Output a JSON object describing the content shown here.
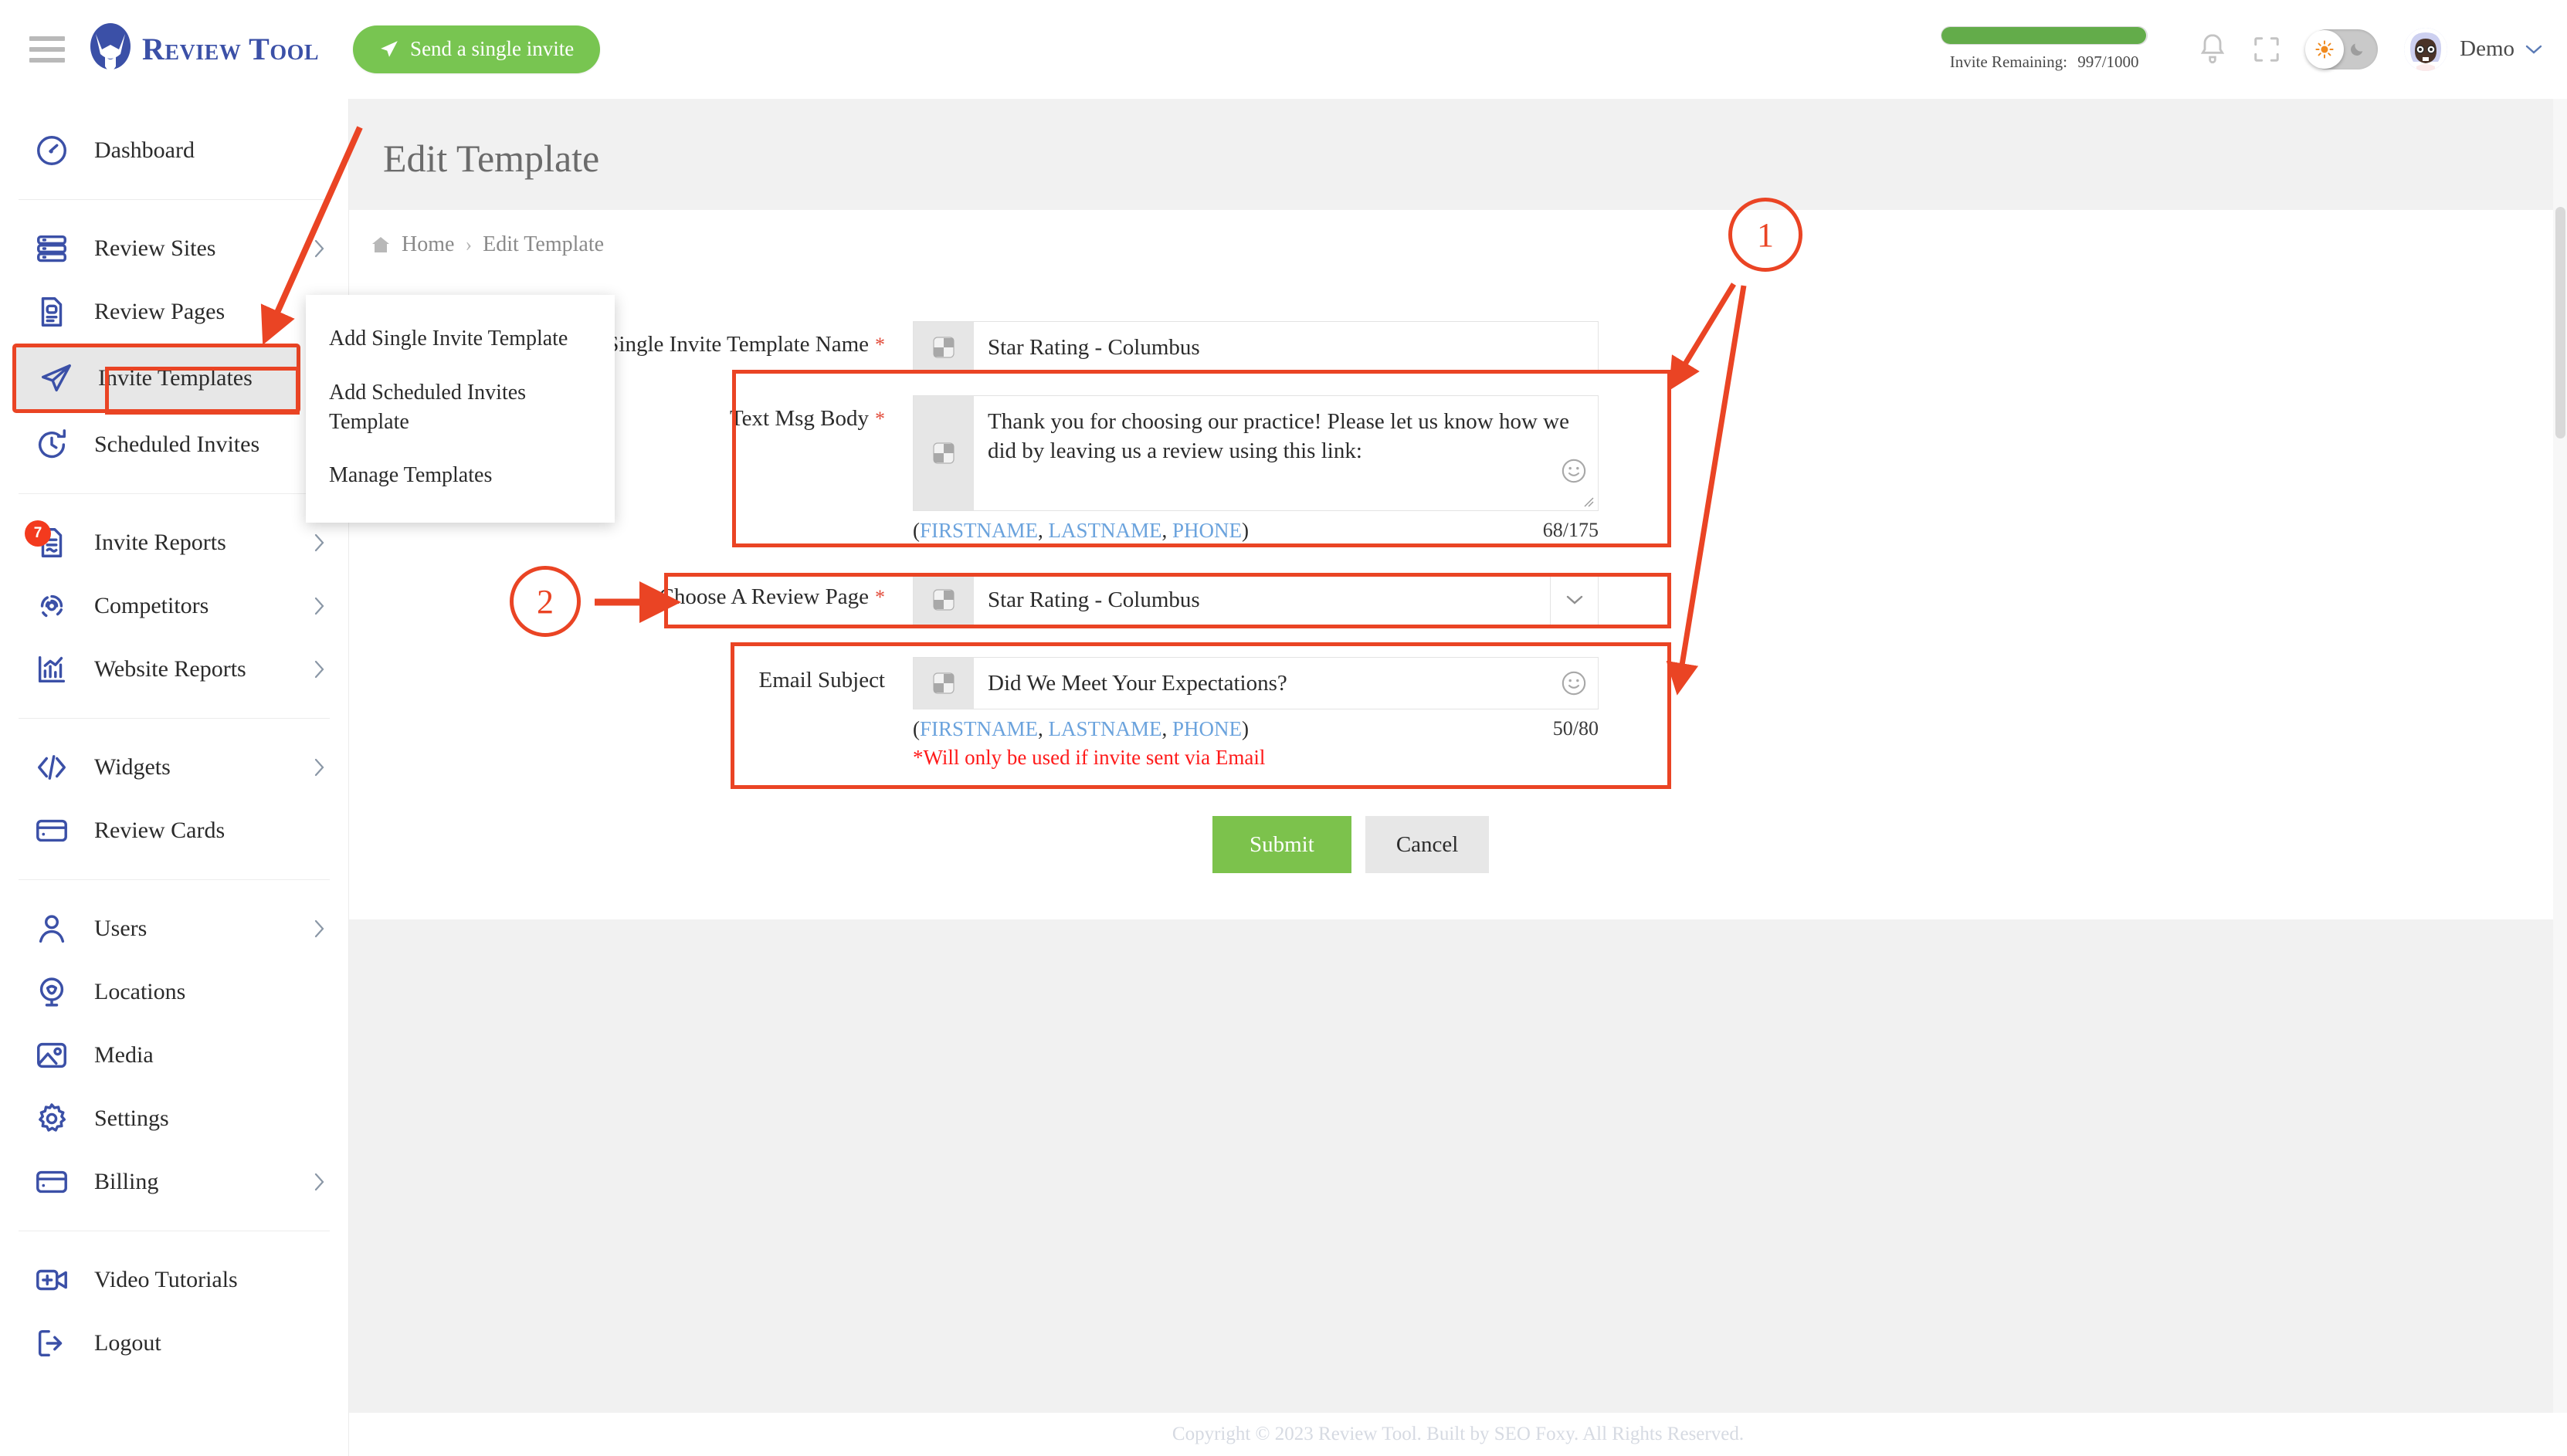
{
  "topbar": {
    "menu_icon": "hamburger-icon",
    "brand_name": "Review Tool",
    "send_invite_label": "Send a single invite",
    "invite_meter": {
      "label": "Invite Remaining:",
      "value": "997/1000",
      "remaining": 997,
      "total": 1000,
      "fill_percent": 99.7,
      "fill_color": "#63ac4a"
    },
    "notification_icon": "bell-icon",
    "fullscreen_icon": "fullscreen-icon",
    "theme_toggle": {
      "state": "light",
      "sun_icon": "sun-icon",
      "moon_icon": "moon-icon"
    },
    "user": {
      "name": "Demo",
      "avatar": "user-avatar",
      "caret": "chevron-down-icon"
    }
  },
  "sidebar": {
    "groups": [
      {
        "items": [
          {
            "label": "Dashboard",
            "icon": "speedometer-icon",
            "has_chevron": false,
            "active": false
          }
        ]
      },
      {
        "items": [
          {
            "label": "Review Sites",
            "icon": "server-stack-icon",
            "has_chevron": true,
            "active": false
          },
          {
            "label": "Review Pages",
            "icon": "page-document-icon",
            "has_chevron": false,
            "active": false
          },
          {
            "label": "Invite Templates",
            "icon": "paper-plane-icon",
            "has_chevron": false,
            "active": true
          },
          {
            "label": "Scheduled Invites",
            "icon": "clock-refresh-icon",
            "has_chevron": false,
            "active": false
          }
        ]
      },
      {
        "items": [
          {
            "label": "Invite Reports",
            "icon": "report-document-icon",
            "has_chevron": true,
            "active": false,
            "badge": "7"
          },
          {
            "label": "Competitors",
            "icon": "fingerprint-icon",
            "has_chevron": true,
            "active": false
          },
          {
            "label": "Website Reports",
            "icon": "bar-chart-icon",
            "has_chevron": true,
            "active": false
          }
        ]
      },
      {
        "items": [
          {
            "label": "Widgets",
            "icon": "code-brackets-icon",
            "has_chevron": true,
            "active": false
          },
          {
            "label": "Review Cards",
            "icon": "credit-card-icon",
            "has_chevron": false,
            "active": false
          }
        ]
      },
      {
        "items": [
          {
            "label": "Users",
            "icon": "person-icon",
            "has_chevron": true,
            "active": false
          },
          {
            "label": "Locations",
            "icon": "map-pin-icon",
            "has_chevron": false,
            "active": false
          },
          {
            "label": "Media",
            "icon": "image-icon",
            "has_chevron": false,
            "active": false
          },
          {
            "label": "Settings",
            "icon": "gear-icon",
            "has_chevron": false,
            "active": false
          },
          {
            "label": "Billing",
            "icon": "credit-card-icon",
            "has_chevron": true,
            "active": false
          }
        ]
      },
      {
        "items": [
          {
            "label": "Video Tutorials",
            "icon": "video-add-icon",
            "has_chevron": false,
            "active": false
          },
          {
            "label": "Logout",
            "icon": "logout-arrow-icon",
            "has_chevron": false,
            "active": false
          }
        ]
      }
    ]
  },
  "submenu": {
    "items": [
      {
        "label": "Add Single Invite Template"
      },
      {
        "label": "Add Scheduled Invites Template"
      },
      {
        "label": "Manage Templates"
      }
    ]
  },
  "main": {
    "page_title": "Edit Template",
    "breadcrumb": {
      "home_icon": "home-icon",
      "home": "Home",
      "separator": "›",
      "current": "Edit Template"
    },
    "form": {
      "fields": {
        "template_name": {
          "label": "Single Invite Template Name",
          "required": true,
          "value": "Star Rating - Columbus",
          "placeholder": "Single Invite Template Name",
          "prefix_icon": "placeholder-image-icon"
        },
        "text_msg_body": {
          "label": "Text Msg Body",
          "required": true,
          "value": "Thank you for choosing our practice! Please let us know how we did by leaving us a review using this link:",
          "placeholder": "Text Msg Body",
          "prefix_icon": "placeholder-image-icon",
          "emoji_icon": "smiley-icon",
          "tokens_prefix": "(",
          "tokens": [
            "FIRSTNAME",
            "LASTNAME",
            "PHONE"
          ],
          "tokens_suffix": ")",
          "counter": "68/175"
        },
        "review_page": {
          "label": "Choose A Review Page",
          "required": true,
          "value": "Star Rating - Columbus",
          "options": [
            "Star Rating - Columbus"
          ],
          "prefix_icon": "placeholder-image-icon",
          "caret_icon": "chevron-down-icon"
        },
        "email_subject": {
          "label": "Email Subject",
          "required": false,
          "value": "Did We Meet Your Expectations?",
          "placeholder": "Email Subject",
          "prefix_icon": "placeholder-image-icon",
          "emoji_icon": "smiley-icon",
          "tokens_prefix": "(",
          "tokens": [
            "FIRSTNAME",
            "LASTNAME",
            "PHONE"
          ],
          "tokens_suffix": ")",
          "counter": "50/80",
          "note": "*Will only be used if invite sent via Email"
        }
      },
      "submit_label": "Submit",
      "cancel_label": "Cancel"
    },
    "footer": "Copyright © 2023 Review Tool. Built by SEO Foxy. All Rights Reserved."
  },
  "annotations": {
    "color": "#ea4424",
    "markers": [
      {
        "id": "1",
        "label": "1"
      },
      {
        "id": "2",
        "label": "2"
      }
    ]
  }
}
